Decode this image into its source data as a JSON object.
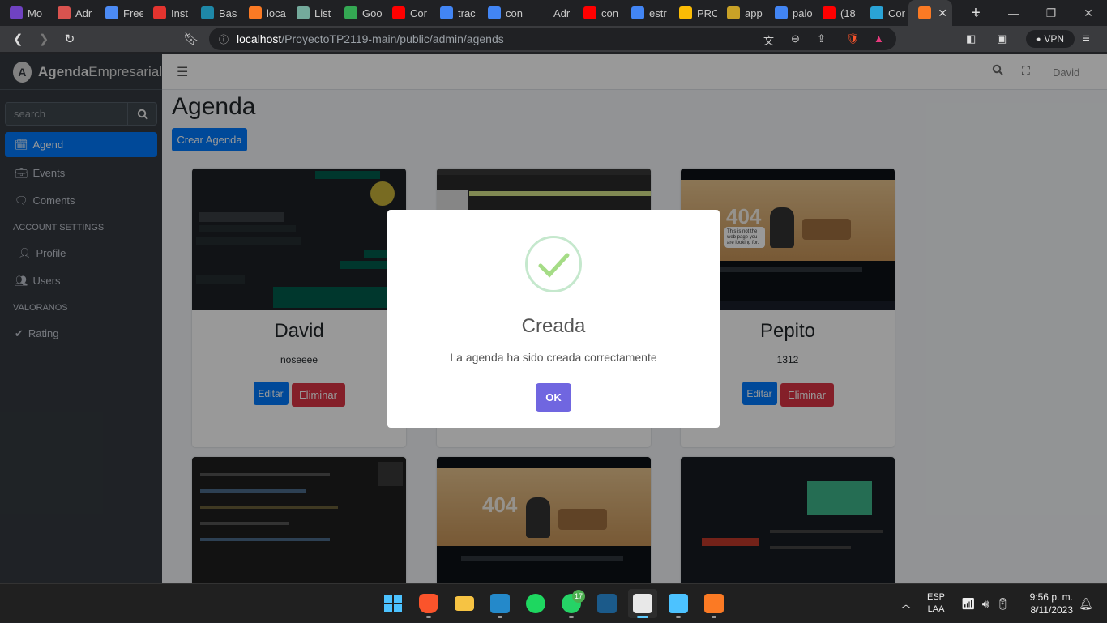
{
  "browser": {
    "tabs": [
      {
        "label": "Mo",
        "icon": "b-letter-icon",
        "color": "#6f42c1"
      },
      {
        "label": "Adr",
        "icon": "dot-icon",
        "color": "#d9534f"
      },
      {
        "label": "Free",
        "icon": "flag-icon",
        "color": "#4c8bf5"
      },
      {
        "label": "Inst",
        "icon": "laravel-icon",
        "color": "#e3342f"
      },
      {
        "label": "Bas",
        "icon": "s-letter-icon",
        "color": "#1e88a8"
      },
      {
        "label": "loca",
        "icon": "xampp-icon",
        "color": "#fb7a24"
      },
      {
        "label": "List",
        "icon": "chatgpt-icon",
        "color": "#74aa9c"
      },
      {
        "label": "Goo",
        "icon": "google-meet-icon",
        "color": "#34a853"
      },
      {
        "label": "Cor",
        "icon": "youtube-icon",
        "color": "#ff0000"
      },
      {
        "label": "trac",
        "icon": "google-icon",
        "color": "#4285f4"
      },
      {
        "label": "con",
        "icon": "google-icon",
        "color": "#4285f4"
      },
      {
        "label": "Adr",
        "icon": "blank-icon",
        "color": "#202124"
      },
      {
        "label": "con",
        "icon": "youtube-icon",
        "color": "#ff0000"
      },
      {
        "label": "estr",
        "icon": "google-icon",
        "color": "#4285f4"
      },
      {
        "label": "PRO",
        "icon": "google-drive-icon",
        "color": "#fbbc05"
      },
      {
        "label": "app",
        "icon": "diamond-icon",
        "color": "#c9a227"
      },
      {
        "label": "palo",
        "icon": "google-icon",
        "color": "#4285f4"
      },
      {
        "label": "(18",
        "icon": "youtube-icon",
        "color": "#ff0000"
      },
      {
        "label": "Cor",
        "icon": "cloud-icon",
        "color": "#2aa3d6"
      },
      {
        "label": "",
        "icon": "xampp-icon",
        "color": "#fb7a24"
      }
    ],
    "url_host": "localhost",
    "url_path": "/ProyectoTP2119-main/public/admin/agends",
    "vpn_label": "VPN"
  },
  "sidebar": {
    "brand_bold": "Agenda",
    "brand_rest": "Empresarial",
    "search_placeholder": "search",
    "items": [
      {
        "label": "Agend",
        "icon": "calendar-icon"
      },
      {
        "label": "Events",
        "icon": "briefcase-icon"
      },
      {
        "label": "Coments",
        "icon": "comments-icon"
      },
      {
        "label": "Profile",
        "icon": "user-icon"
      },
      {
        "label": "Users",
        "icon": "users-icon"
      },
      {
        "label": "Rating",
        "icon": "check-icon"
      }
    ],
    "headers": [
      "ACCOUNT SETTINGS",
      "VALORANOS"
    ]
  },
  "header": {
    "user": "David"
  },
  "main": {
    "title": "Agenda",
    "create_button": "Crear Agenda",
    "cards": [
      {
        "name": "David",
        "description": "noseeee",
        "edit": "Editar",
        "delete": "Eliminar"
      },
      {
        "name": "",
        "description": "",
        "edit": "",
        "delete": ""
      },
      {
        "name": "Pepito",
        "description": "1312",
        "edit": "Editar",
        "delete": "Eliminar"
      }
    ],
    "screenshot_text": {
      "not_found_code": "404",
      "not_found_msg": "This is not the web page you are looking for."
    }
  },
  "modal": {
    "title": "Creada",
    "text": "La agenda ha sido creada correctamente",
    "ok": "OK"
  },
  "taskbar": {
    "lang_top": "ESP",
    "lang_bottom": "LAA",
    "time": "9:56 p. m.",
    "date": "8/11/2023",
    "whatsapp_badge": "17"
  }
}
